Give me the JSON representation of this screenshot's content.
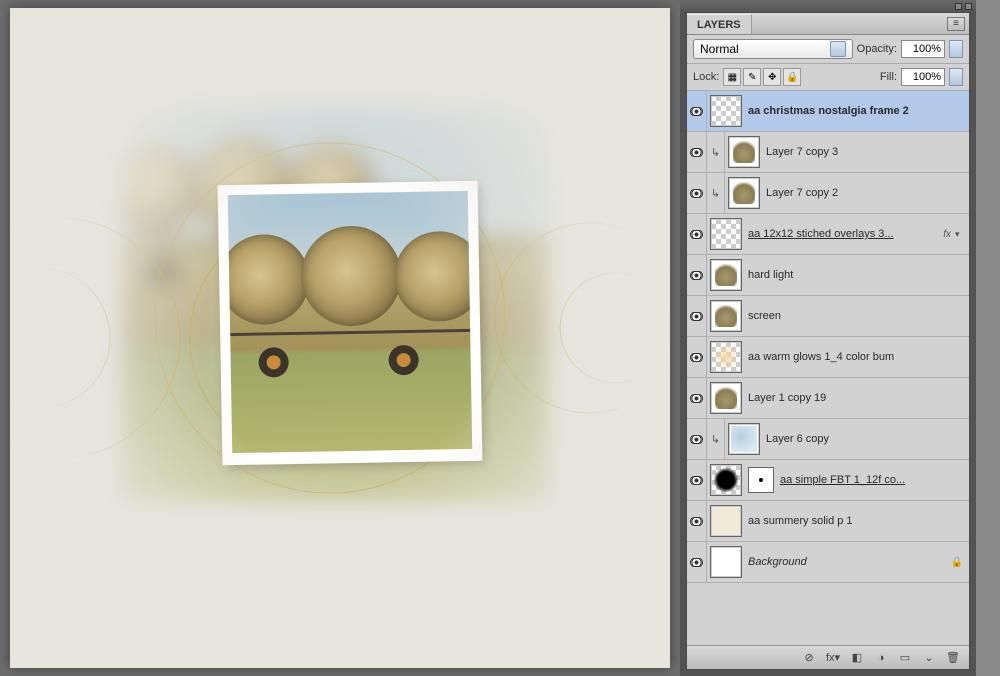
{
  "panel": {
    "title": "LAYERS",
    "blend_mode": "Normal",
    "opacity_label": "Opacity:",
    "opacity_value": "100%",
    "lock_label": "Lock:",
    "fill_label": "Fill:",
    "fill_value": "100%"
  },
  "lock_icons": [
    "▦",
    "✎",
    "✥",
    "🔒"
  ],
  "layers": [
    {
      "name": "aa christmas nostalgia frame 2",
      "visible": true,
      "selected": true,
      "indented": false,
      "thumb": "trans",
      "underline": false,
      "bold": true
    },
    {
      "name": "Layer 7 copy 3",
      "visible": true,
      "selected": false,
      "indented": true,
      "clip": true,
      "thumb": "img"
    },
    {
      "name": "Layer 7 copy 2",
      "visible": true,
      "selected": false,
      "indented": true,
      "clip": true,
      "thumb": "img"
    },
    {
      "name": "aa 12x12 stiched overlays 3...",
      "visible": true,
      "selected": false,
      "indented": false,
      "thumb": "trans",
      "underline": true,
      "fx": true
    },
    {
      "name": "hard light",
      "visible": true,
      "selected": false,
      "indented": false,
      "thumb": "img"
    },
    {
      "name": "screen",
      "visible": true,
      "selected": false,
      "indented": false,
      "thumb": "img"
    },
    {
      "name": "aa warm glows 1_4 color bum",
      "visible": true,
      "selected": false,
      "indented": false,
      "thumb": "glow"
    },
    {
      "name": "Layer 1 copy 19",
      "visible": true,
      "selected": false,
      "indented": false,
      "thumb": "img"
    },
    {
      "name": "Layer 6 copy",
      "visible": true,
      "selected": false,
      "indented": true,
      "clip": true,
      "thumb": "blue"
    },
    {
      "name": "aa simple FBT 1_12f co...",
      "visible": true,
      "selected": false,
      "indented": false,
      "thumb": "black",
      "mask": true,
      "underline": true
    },
    {
      "name": "aa summery solid p 1",
      "visible": true,
      "selected": false,
      "indented": false,
      "thumb": "cream"
    },
    {
      "name": "Background",
      "visible": true,
      "selected": false,
      "indented": false,
      "thumb": "white",
      "italic": true,
      "locked": true
    }
  ],
  "footer_icons": [
    "⊘",
    "fx▾",
    "◧",
    "◑",
    "▭",
    "⌄",
    "🗑"
  ]
}
